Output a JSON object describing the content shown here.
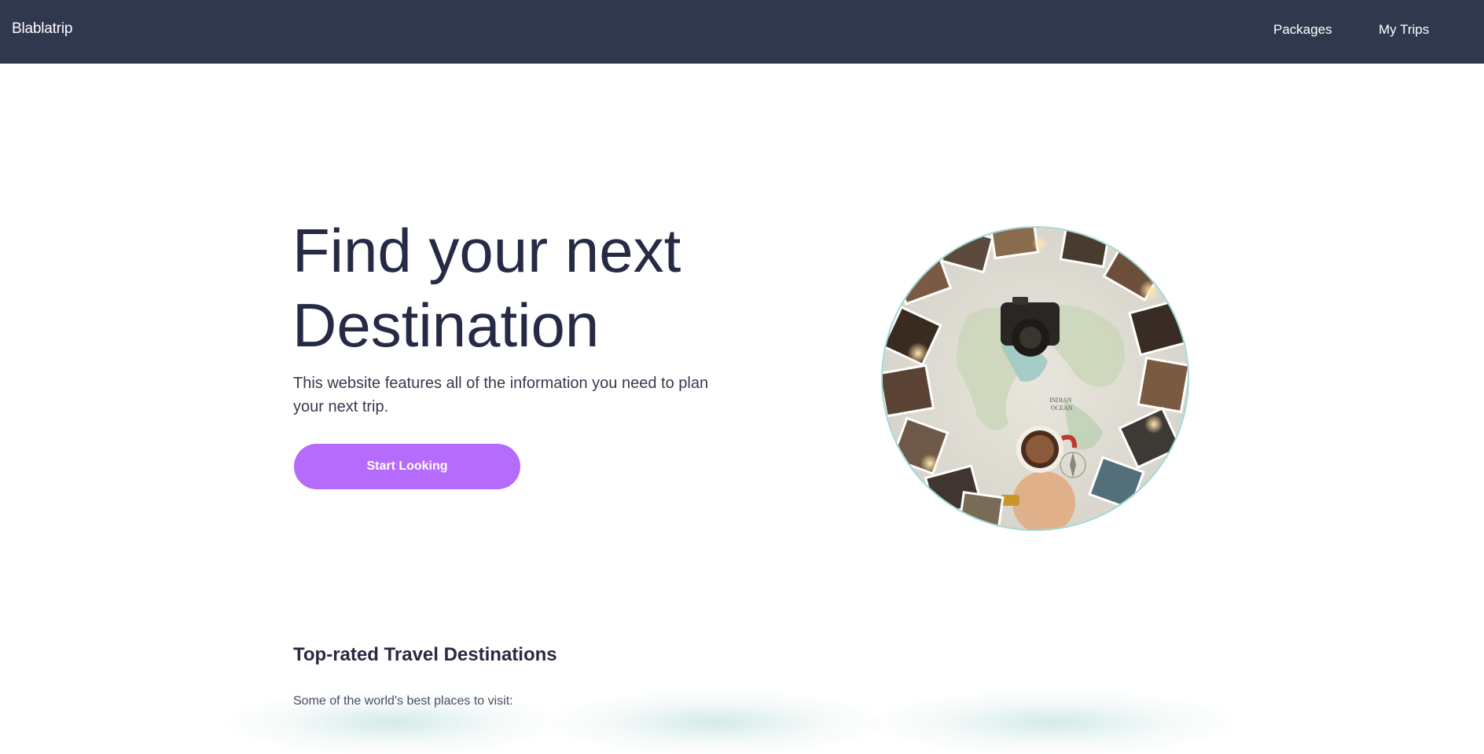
{
  "navbar": {
    "brand": "Blablatrip",
    "links": [
      {
        "label": "Packages"
      },
      {
        "label": "My Trips"
      }
    ],
    "background_color": "#30384d"
  },
  "hero": {
    "title": "Find your next Destination",
    "subtitle": "This website features all of the information you need to plan your next trip.",
    "cta_label": "Start Looking",
    "cta_color": "#b56bfb",
    "image_description_icon": "travel-map-photo"
  },
  "destinations": {
    "title": "Top-rated Travel Destinations",
    "subtitle": "Some of the world's best places to visit:"
  }
}
